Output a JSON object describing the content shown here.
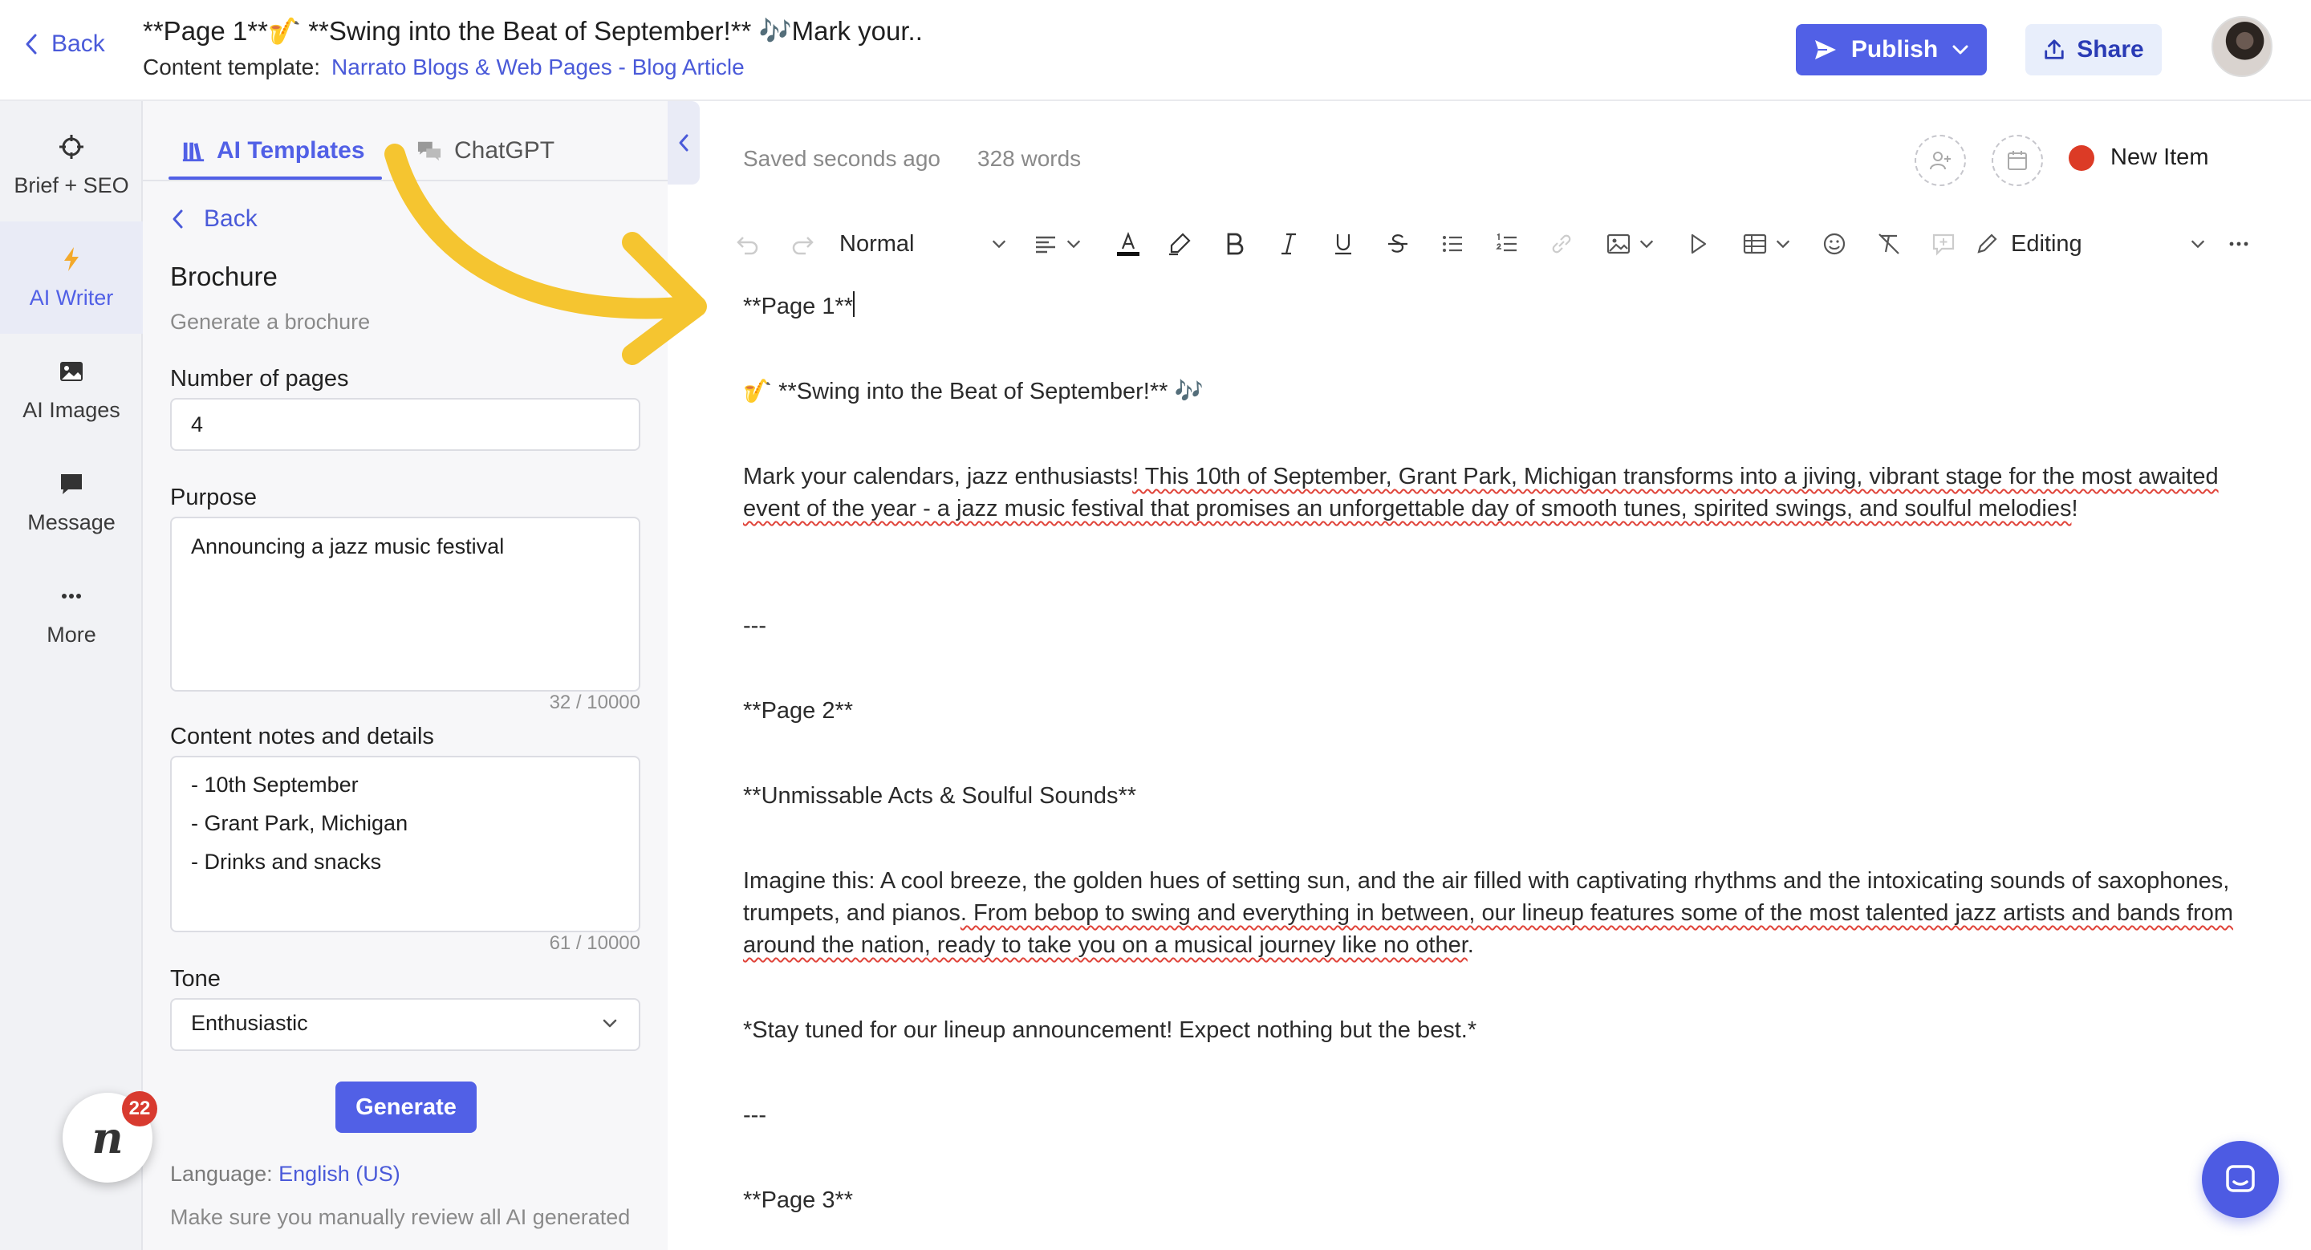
{
  "header": {
    "back_label": "Back",
    "title": "**Page 1**🎷 **Swing into the Beat of September!** 🎶Mark your..",
    "template_label": "Content template:",
    "template_link": "Narrato Blogs & Web Pages - Blog Article",
    "publish_label": "Publish",
    "share_label": "Share"
  },
  "rail": {
    "items": [
      {
        "label": "Brief + SEO",
        "icon": "crosshair-icon"
      },
      {
        "label": "AI Writer",
        "icon": "lightning-icon"
      },
      {
        "label": "AI Images",
        "icon": "image-icon"
      },
      {
        "label": "Message",
        "icon": "message-icon"
      },
      {
        "label": "More",
        "icon": "more-dots-icon"
      }
    ]
  },
  "panel": {
    "tabs": [
      {
        "label": "AI Templates",
        "icon": "library-icon"
      },
      {
        "label": "ChatGPT",
        "icon": "chat-bubbles-icon"
      }
    ],
    "back_label": "Back",
    "form_title": "Brochure",
    "form_subtitle": "Generate a brochure",
    "pages_label": "Number of pages",
    "pages_value": "4",
    "purpose_label": "Purpose",
    "purpose_value": "Announcing a jazz music festival",
    "purpose_counter": "32 / 10000",
    "notes_label": "Content notes and details",
    "notes_lines": [
      "- 10th September",
      "- Grant Park, Michigan",
      "- Drinks and snacks"
    ],
    "notes_counter": "61 / 10000",
    "tone_label": "Tone",
    "tone_value": "Enthusiastic",
    "generate_label": "Generate",
    "language_label": "Language:",
    "language_value": "English (US)",
    "review_note": "Make sure you manually review all AI generated",
    "badge_count": "22"
  },
  "editor": {
    "status": "Saved seconds ago",
    "word_count": "328 words",
    "new_item_label": "New Item",
    "new_item_color": "#dc3b26",
    "style_select": "Normal",
    "mode_select": "Editing",
    "p1": "**Page 1**",
    "p2": "🎷 **Swing into the Beat of September!** 🎶",
    "p3_a": "Mark your calendars, jazz enthusiasts",
    "p3_b": "! This 10th of September, Grant Park, Michigan transforms into a jiving, vibrant stage for the most awaited event of the year - a jazz music festival that promises an unforgettable day of smooth tunes, spirited swings, and soulful melodies",
    "p3_c": "!",
    "sep1": "---",
    "p4": "**Page 2**",
    "p5": "**Unmissable Acts & Soulful Sounds**",
    "p6_a": "Imagine this: A cool breeze, the golden hues of setting sun, and the air filled with captivating rhythms and the intoxicating sounds of saxophones, trumpets, and pianos",
    "p6_b": ". From bebop to swing and everything in between, our lineup features some of the most talented jazz artists and bands from around the nation, ready to take you on a musical journey like no other",
    "p6_c": ".",
    "p7": "*Stay tuned for our lineup announcement! Expect nothing but the best.*",
    "sep2": "---",
    "p8": "**Page 3**"
  },
  "colors": {
    "accent": "#5160e6",
    "link": "#4a5ad9",
    "arrow": "#f5c530"
  }
}
